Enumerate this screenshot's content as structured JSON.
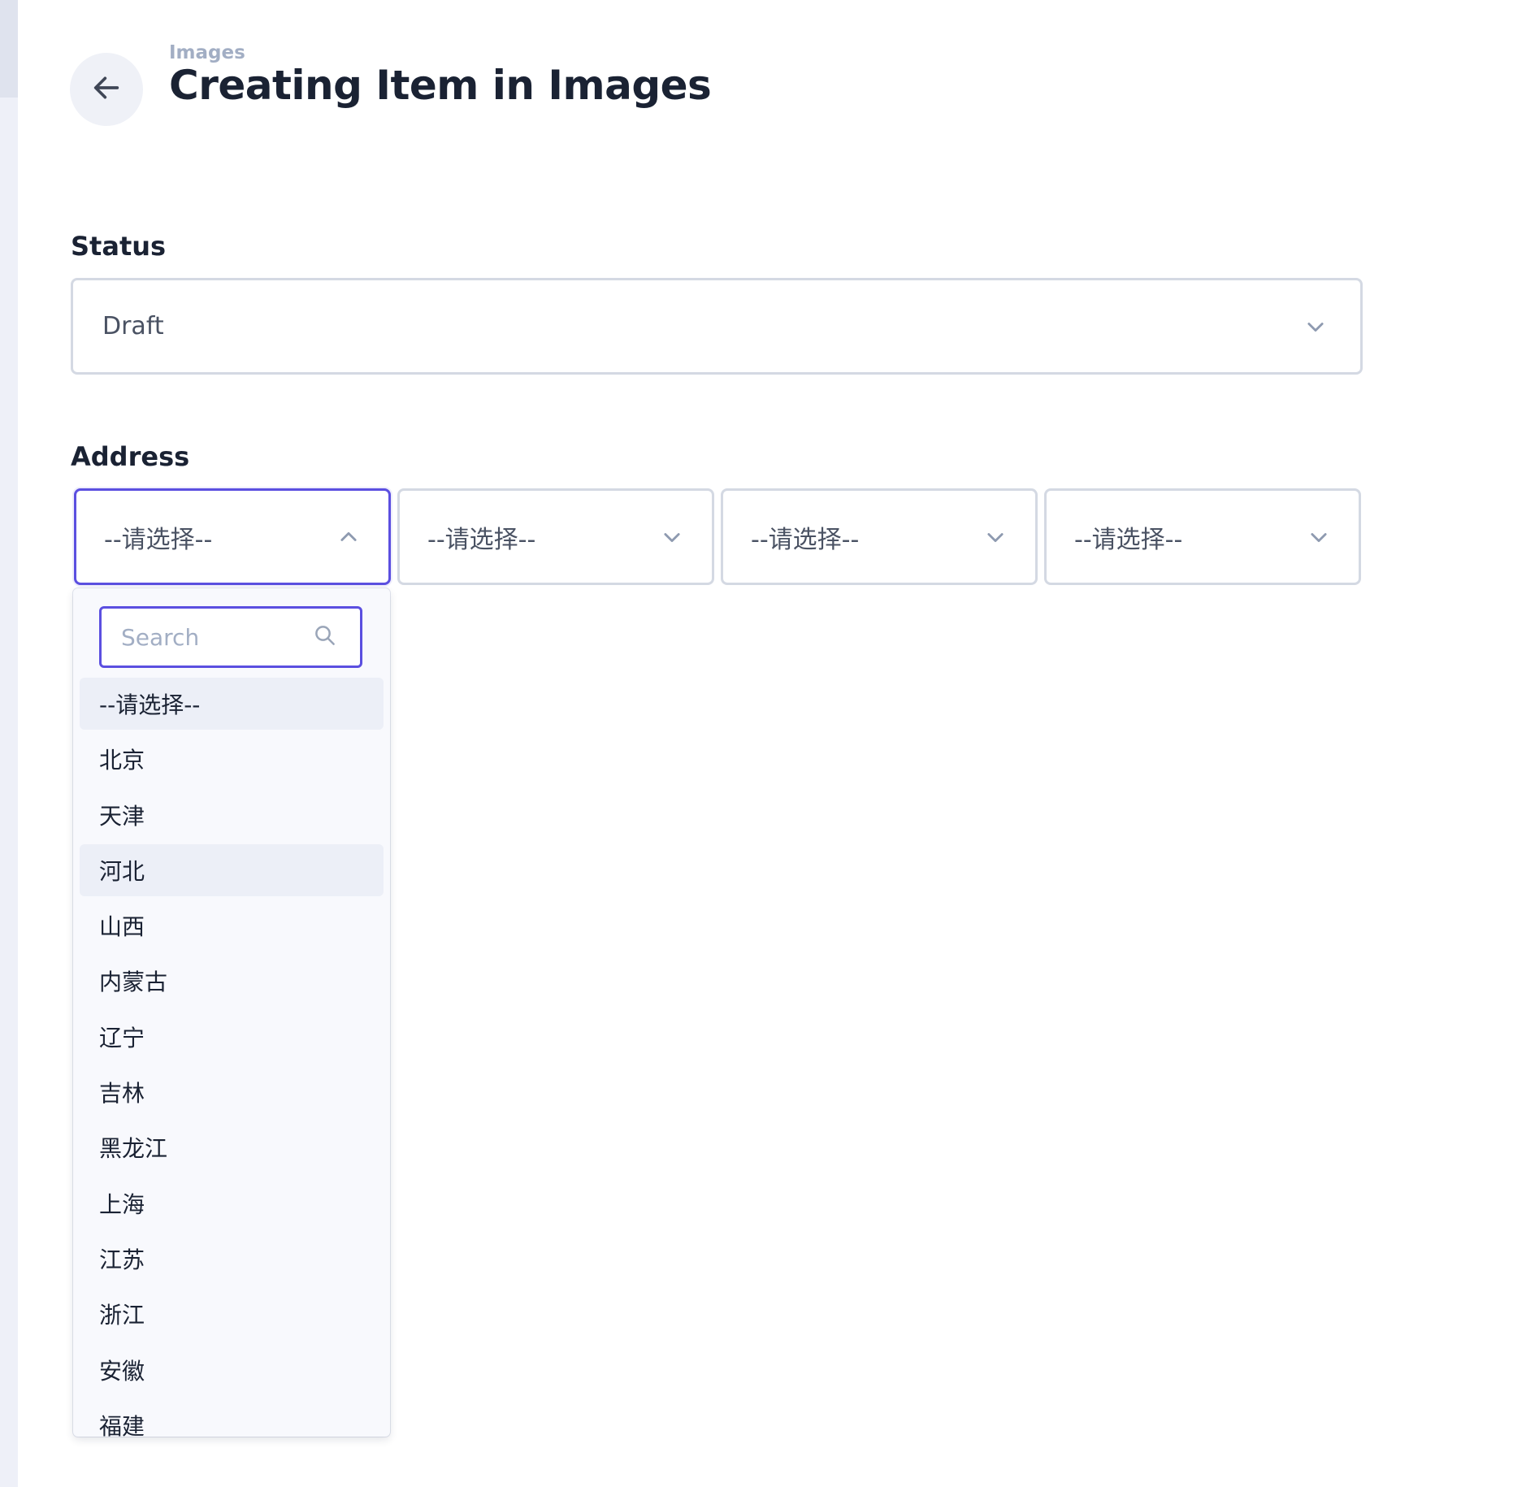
{
  "header": {
    "breadcrumb": "Images",
    "title": "Creating Item in Images"
  },
  "status": {
    "label": "Status",
    "value": "Draft"
  },
  "address": {
    "label": "Address",
    "selects": [
      {
        "value": "--请选择--",
        "open": true
      },
      {
        "value": "--请选择--",
        "open": false
      },
      {
        "value": "--请选择--",
        "open": false
      },
      {
        "value": "--请选择--",
        "open": false
      }
    ],
    "dropdown": {
      "search_placeholder": "Search",
      "options": [
        "--请选择--",
        "北京",
        "天津",
        "河北",
        "山西",
        "内蒙古",
        "辽宁",
        "吉林",
        "黑龙江",
        "上海",
        "江苏",
        "浙江",
        "安徽",
        "福建"
      ],
      "selected_option": "--请选择--",
      "hovered_option": "河北"
    }
  },
  "colors": {
    "accent": "#5b4fe0",
    "border": "#d4d9e3",
    "text": "#1a2233",
    "muted": "#a2aec4",
    "highlight": "#eceff7"
  }
}
